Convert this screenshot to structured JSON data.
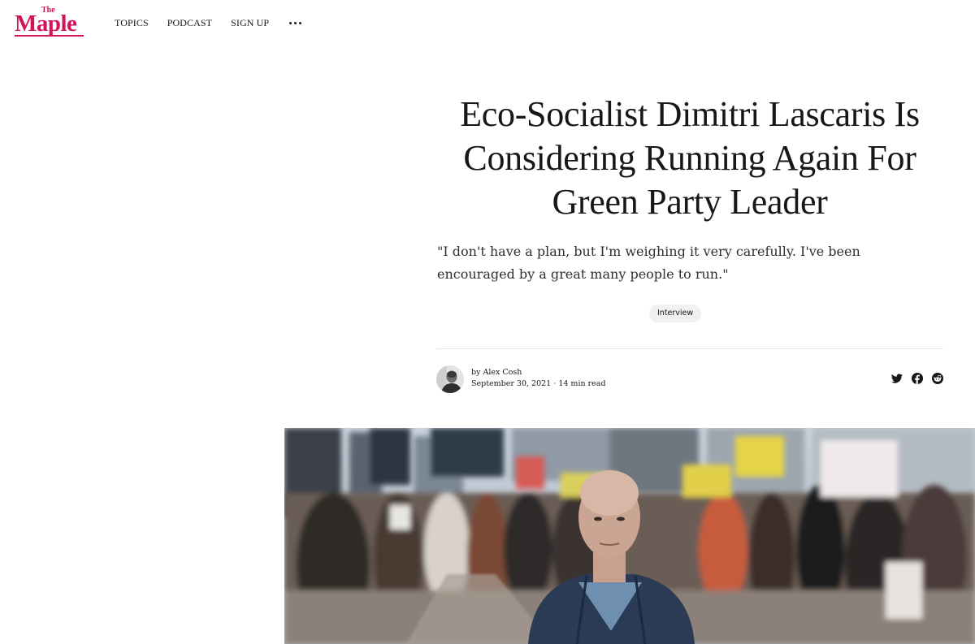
{
  "brand": {
    "the": "The",
    "name": "Maple",
    "color": "#d3145a"
  },
  "nav": {
    "items": [
      {
        "label": "TOPICS"
      },
      {
        "label": "PODCAST"
      },
      {
        "label": "SIGN UP"
      }
    ],
    "more_icon": "ellipsis-icon"
  },
  "article": {
    "title": "Eco-Socialist Dimitri Lascaris Is Considering Running Again For Green Party Leader",
    "excerpt": "\"I don't have a plan, but I'm weighing it very carefully. I've been encouraged by a great many people to run.\"",
    "tag": "Interview",
    "author_line": "by Alex Cosh",
    "date": "September 30, 2021",
    "separator": "·",
    "read_time": "14 min read"
  },
  "share": {
    "icons": [
      "twitter-icon",
      "facebook-icon",
      "reddit-icon"
    ]
  },
  "feature_image": {
    "subject": "man-in-front-of-street-march-photo"
  }
}
